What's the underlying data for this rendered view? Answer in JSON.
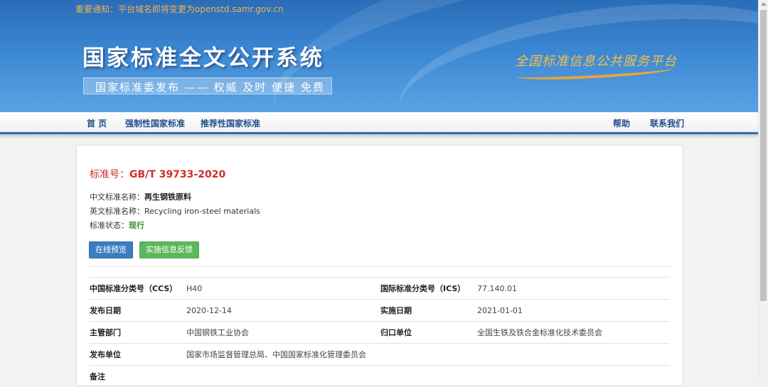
{
  "banner": {
    "notice": "重要通知：平台域名即将变更为openstd.samr.gov.cn",
    "system_title": "国家标准全文公开系统",
    "slogan": "国家标准委发布 —— 权威 及时 便捷 免费",
    "platform": "全国标准信息公共服务平台"
  },
  "nav": {
    "home": "首 页",
    "mandatory": "强制性国家标准",
    "recommended": "推荐性国家标准",
    "help": "帮助",
    "contact": "联系我们"
  },
  "standard": {
    "number_label": "标准号：",
    "number": "GB/T 39733-2020",
    "cn_name_label": "中文标准名称：",
    "cn_name": "再生钢铁原料",
    "en_name_label": "英文标准名称：",
    "en_name": "Recycling iron-steel materials",
    "status_label": "标准状态：",
    "status": "现行"
  },
  "buttons": {
    "preview": "在线预览",
    "feedback": "实施信息反馈"
  },
  "details": {
    "ccs_label": "中国标准分类号（CCS）",
    "ccs": "H40",
    "ics_label": "国际标准分类号（ICS）",
    "ics": "77.140.01",
    "publish_date_label": "发布日期",
    "publish_date": "2020-12-14",
    "implement_date_label": "实施日期",
    "implement_date": "2021-01-01",
    "authority_label": "主管部门",
    "authority": "中国钢铁工业协会",
    "owner_label": "归口单位",
    "owner": "全国生铁及铁合金标准化技术委员会",
    "publisher_label": "发布单位",
    "publisher": "国家市场监督管理总局、中国国家标准化管理委员会",
    "remark_label": "备注"
  },
  "colors": {
    "banner_blue": "#2a6cb8",
    "nav_text": "#1f4e8c",
    "std_number_red": "#c9302c",
    "status_green": "#2e8b2e",
    "preview_button": "#3a7ebf",
    "feedback_button": "#5cb85c"
  }
}
